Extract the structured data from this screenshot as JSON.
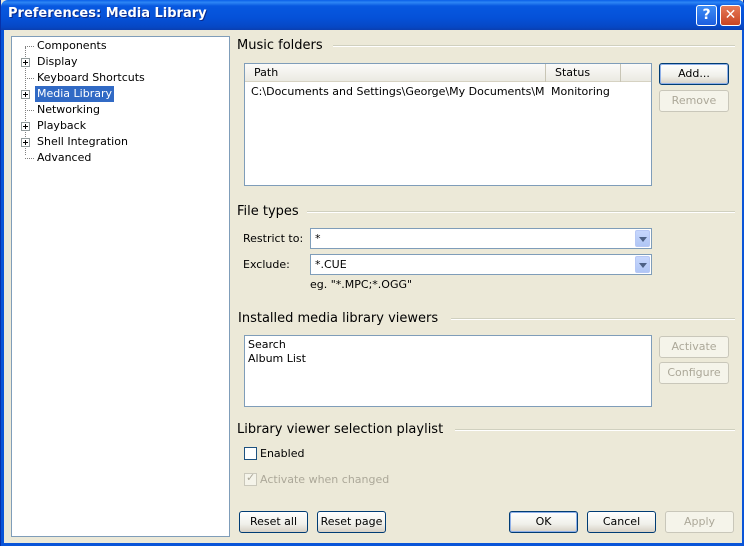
{
  "window": {
    "title": "Preferences: Media Library"
  },
  "icons": {
    "help": "help-icon",
    "close": "close-icon"
  },
  "tree": {
    "items": [
      {
        "label": "Components",
        "expandable": false,
        "selected": false
      },
      {
        "label": "Display",
        "expandable": true,
        "selected": false
      },
      {
        "label": "Keyboard Shortcuts",
        "expandable": false,
        "selected": false
      },
      {
        "label": "Media Library",
        "expandable": true,
        "selected": true
      },
      {
        "label": "Networking",
        "expandable": false,
        "selected": false
      },
      {
        "label": "Playback",
        "expandable": true,
        "selected": false
      },
      {
        "label": "Shell Integration",
        "expandable": true,
        "selected": false
      },
      {
        "label": "Advanced",
        "expandable": false,
        "selected": false
      }
    ]
  },
  "music_folders": {
    "title": "Music folders",
    "columns": [
      "Path",
      "Status"
    ],
    "rows": [
      {
        "path": "C:\\Documents and Settings\\George\\My Documents\\My Music",
        "status": "Monitoring"
      }
    ],
    "add_label": "Add...",
    "remove_label": "Remove"
  },
  "file_types": {
    "title": "File types",
    "restrict_label": "Restrict to:",
    "restrict_value": "*",
    "exclude_label": "Exclude:",
    "exclude_value": "*.CUE",
    "hint": "eg. \"*.MPC;*.OGG\""
  },
  "viewers": {
    "title": "Installed media library viewers",
    "items": [
      "Search",
      "Album List"
    ],
    "activate_label": "Activate",
    "configure_label": "Configure"
  },
  "playlist": {
    "title": "Library viewer selection playlist",
    "enabled_label": "Enabled",
    "enabled_checked": false,
    "activate_when_changed_label": "Activate when changed",
    "activate_when_changed_checked": true
  },
  "footer": {
    "reset_all": "Reset all",
    "reset_page": "Reset page",
    "ok": "OK",
    "cancel": "Cancel",
    "apply": "Apply"
  },
  "colors": {
    "titlebar": "#0551d8",
    "dialog_bg": "#ece9d8",
    "selection": "#316ac5"
  }
}
